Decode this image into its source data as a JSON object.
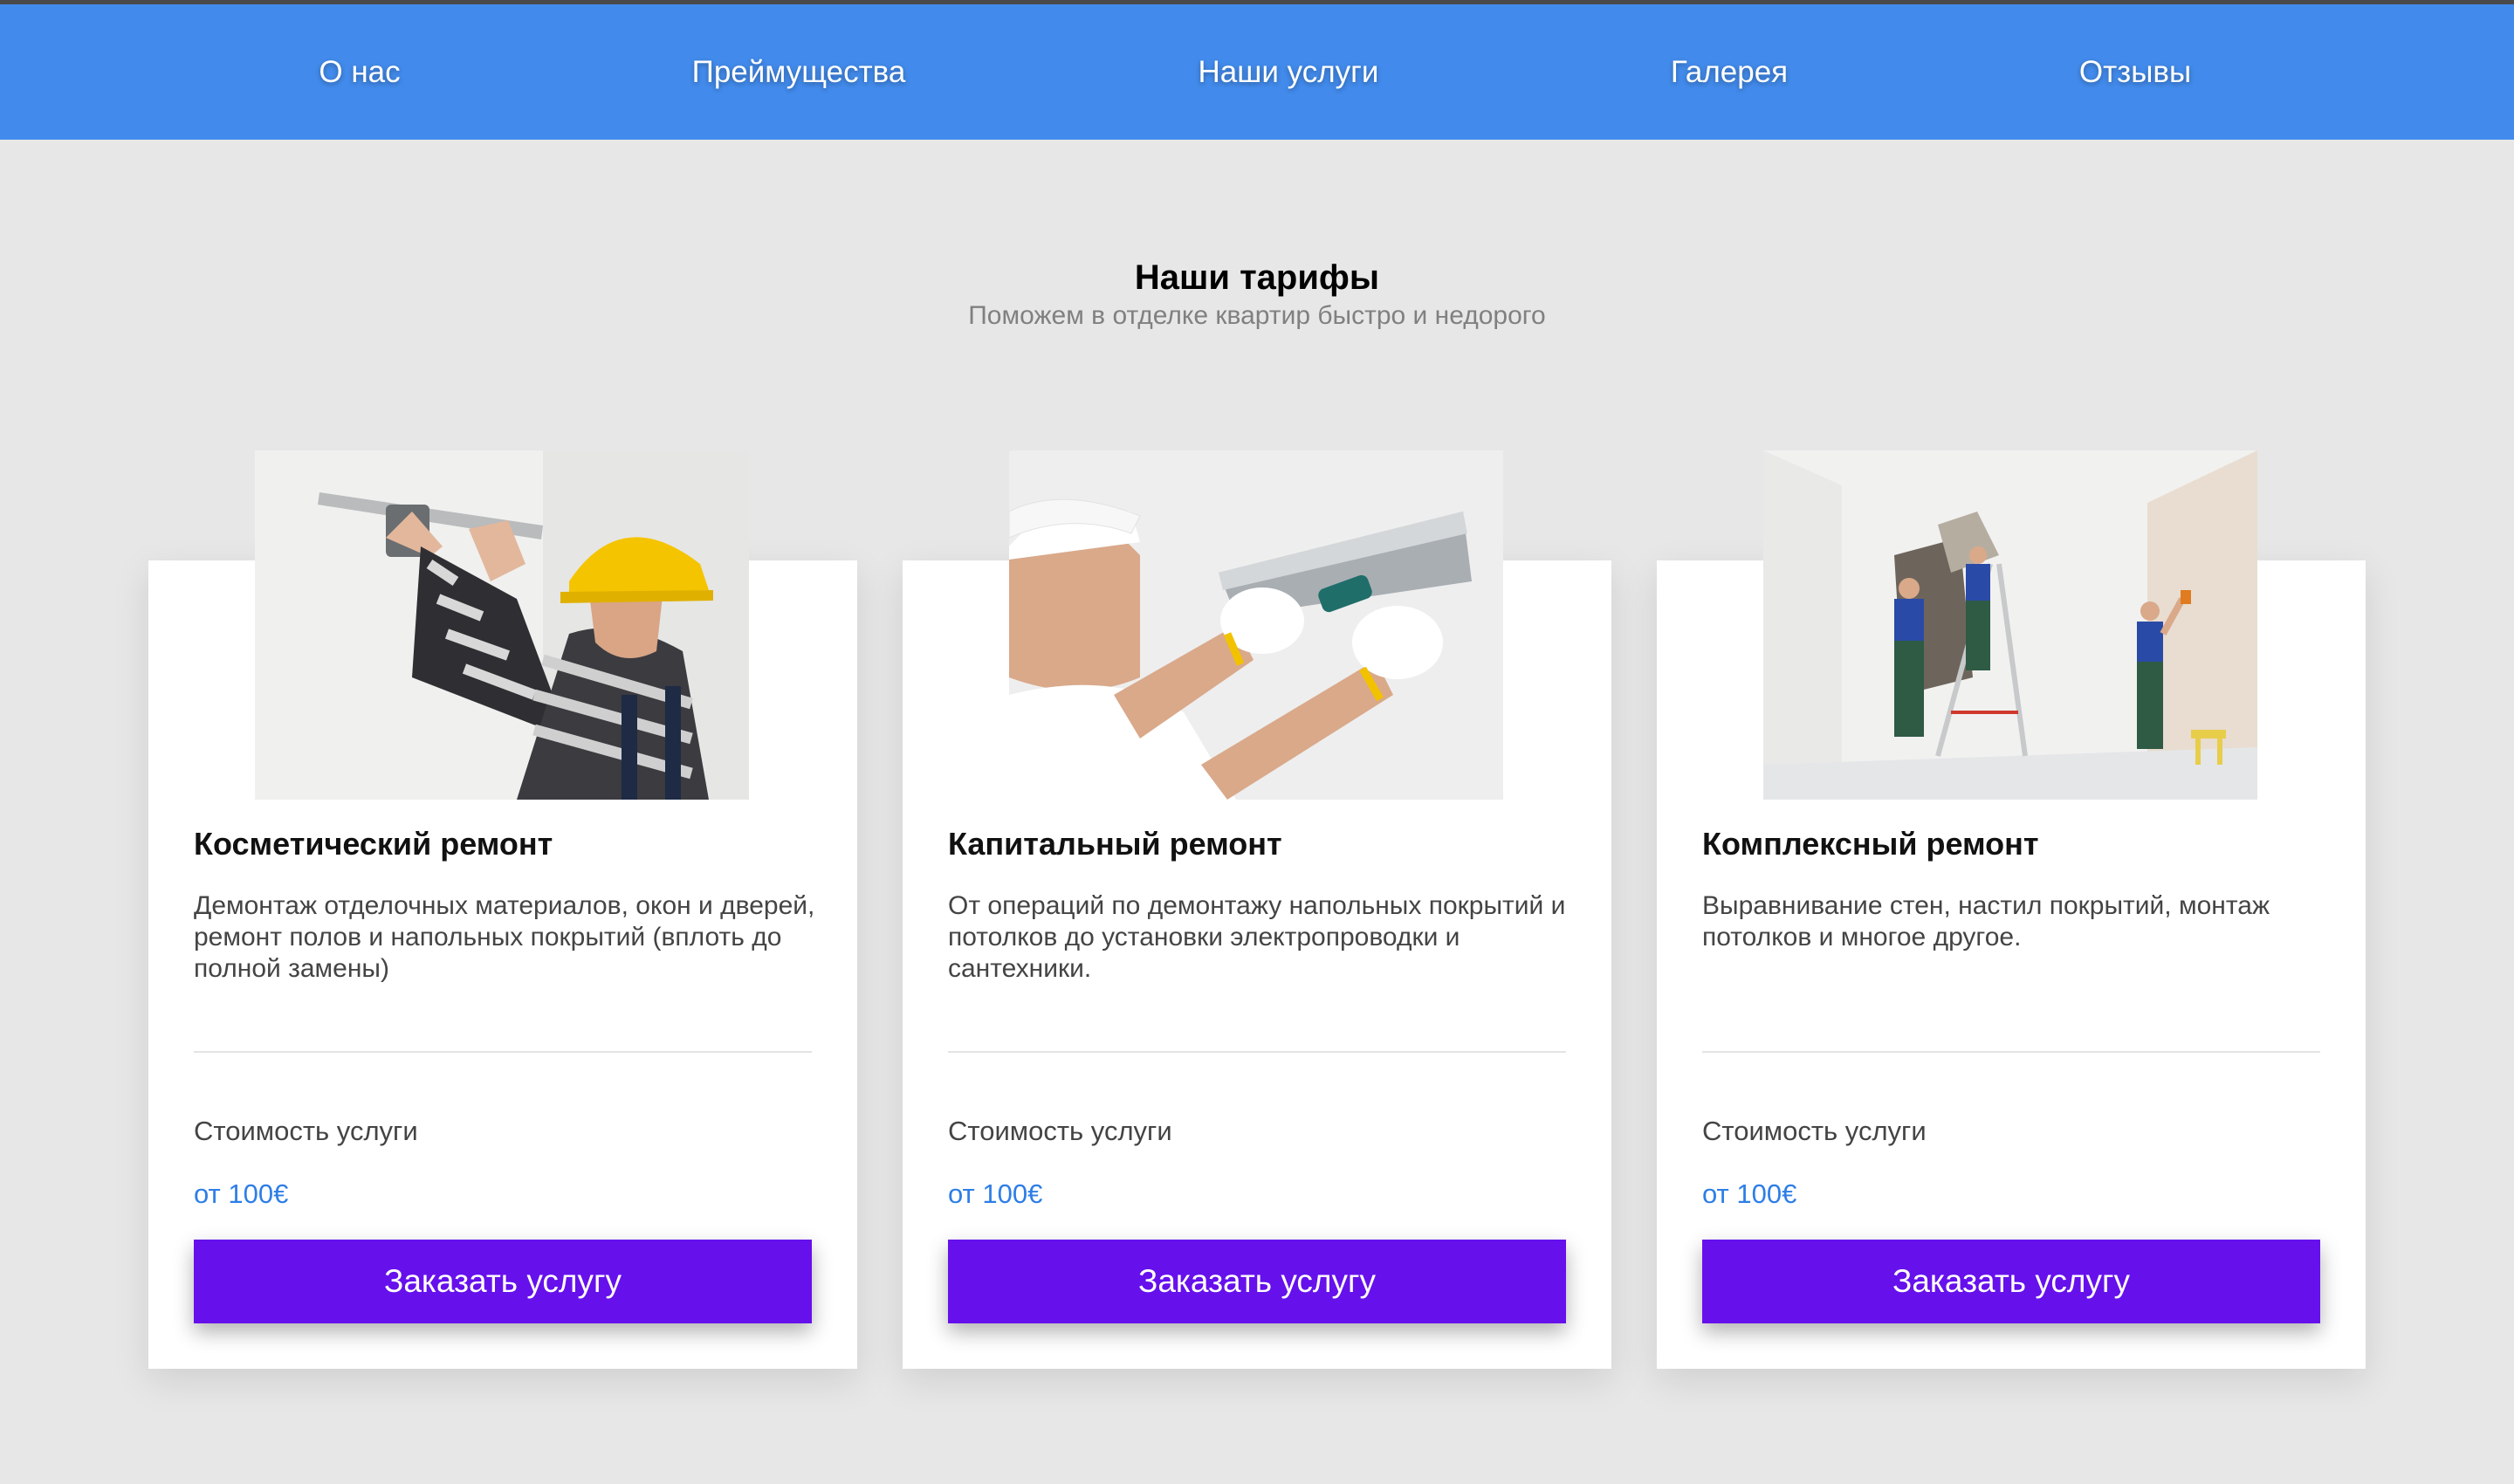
{
  "nav": {
    "items": [
      {
        "label": "О нас"
      },
      {
        "label": "Преймущества"
      },
      {
        "label": "Наши услуги"
      },
      {
        "label": "Галерея"
      },
      {
        "label": "Отзывы"
      }
    ]
  },
  "section": {
    "title": "Наши тарифы",
    "subtitle": "Поможем в отделке квартир быстро и недорого"
  },
  "cards": [
    {
      "title": "Косметический ремонт",
      "description": "Демонтаж отделочных материалов, окон и дверей, ремонт полов и напольных покрытий (вплоть до полной замены)",
      "price_label": "Стоимость услуги",
      "price": "от 100€",
      "button": "Заказать услугу"
    },
    {
      "title": "Капитальный ремонт",
      "description": "От операций по демонтажу напольных покрытий и потолков до установки электропроводки и сантехники.",
      "price_label": "Стоимость услуги",
      "price": "от 100€",
      "button": "Заказать услугу"
    },
    {
      "title": "Комплексный ремонт",
      "description": "Выравнивание стен, настил покрытий, монтаж потолков и многое другое.",
      "price_label": "Стоимость услуги",
      "price": "от 100€",
      "button": "Заказать услугу"
    }
  ],
  "colors": {
    "nav_bg": "#428bec",
    "page_bg": "#e7e7e7",
    "button_bg": "#6610ec",
    "price": "#2e7ee6"
  }
}
